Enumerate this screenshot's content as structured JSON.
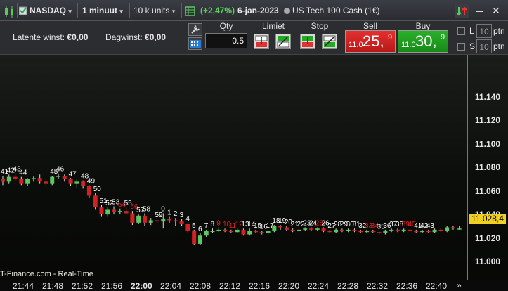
{
  "topbar": {
    "symbol": "NASDAQ",
    "timeframe": "1 minuut",
    "units": "10 k units",
    "change": "(+2,47%)",
    "date": "6-jan-2023",
    "instrument": "US Tech 100 Cash (1€)"
  },
  "panel": {
    "latent_label": "Latente winst:",
    "latent_value": "€0,00",
    "day_label": "Dagwinst:",
    "day_value": "€0,00",
    "qty_label": "Qty",
    "qty_value": "0.5",
    "limit_label": "Limiet",
    "stop_label": "Stop",
    "sell_label": "Sell",
    "buy_label": "Buy",
    "sell_small": "11.0",
    "sell_big": "25,",
    "sell_sup": "9",
    "buy_small": "11.0",
    "buy_big": "30,",
    "buy_sup": "9",
    "l_label": "L",
    "s_label": "S",
    "l_value": "10",
    "s_value": "10",
    "ptn_label": "ptn"
  },
  "chart_data": {
    "type": "candlestick",
    "yticks": [
      "11.140",
      "11.120",
      "11.100",
      "11.080",
      "11.060",
      "11.040",
      "11.020",
      "11.000"
    ],
    "xticks": [
      "21:44",
      "21:48",
      "21:52",
      "21:56",
      "22:00",
      "22:04",
      "22:08",
      "22:12",
      "22:16",
      "22:20",
      "22:24",
      "22:28",
      "22:32",
      "22:36",
      "22:40"
    ],
    "current_price": "11.028,4",
    "watermark": "T-Finance.com - Real-Time",
    "colors": {
      "up": "#5cc85c",
      "down": "#d42020",
      "price_box": "#f0d020"
    },
    "candles": [
      {
        "o": 11070,
        "c": 11068,
        "h": 11073,
        "l": 11065
      },
      {
        "o": 11068,
        "c": 11072,
        "h": 11074,
        "l": 11066
      },
      {
        "o": 11072,
        "c": 11070,
        "h": 11075,
        "l": 11068
      },
      {
        "o": 11070,
        "c": 11066,
        "h": 11072,
        "l": 11065
      },
      {
        "o": 11066,
        "c": 11070,
        "h": 11071,
        "l": 11064
      },
      {
        "o": 11070,
        "c": 11071,
        "h": 11073,
        "l": 11068
      },
      {
        "o": 11071,
        "c": 11068,
        "h": 11074,
        "l": 11066
      },
      {
        "o": 11068,
        "c": 11066,
        "h": 11070,
        "l": 11064
      },
      {
        "o": 11066,
        "c": 11072,
        "h": 11073,
        "l": 11065
      },
      {
        "o": 11072,
        "c": 11073,
        "h": 11075,
        "l": 11070
      },
      {
        "o": 11073,
        "c": 11070,
        "h": 11074,
        "l": 11068
      },
      {
        "o": 11070,
        "c": 11066,
        "h": 11071,
        "l": 11064
      },
      {
        "o": 11066,
        "c": 11068,
        "h": 11070,
        "l": 11063
      },
      {
        "o": 11068,
        "c": 11064,
        "h": 11069,
        "l": 11062
      },
      {
        "o": 11064,
        "c": 11056,
        "h": 11065,
        "l": 11054
      },
      {
        "o": 11056,
        "c": 11046,
        "h": 11058,
        "l": 11044
      },
      {
        "o": 11046,
        "c": 11040,
        "h": 11048,
        "l": 11038
      },
      {
        "o": 11040,
        "c": 11044,
        "h": 11046,
        "l": 11038
      },
      {
        "o": 11044,
        "c": 11042,
        "h": 11047,
        "l": 11040
      },
      {
        "o": 11042,
        "c": 11043,
        "h": 11045,
        "l": 11040
      },
      {
        "o": 11043,
        "c": 11041,
        "h": 11046,
        "l": 11040
      },
      {
        "o": 11041,
        "c": 11033,
        "h": 11043,
        "l": 11031
      },
      {
        "o": 11033,
        "c": 11039,
        "h": 11040,
        "l": 11032
      },
      {
        "o": 11039,
        "c": 11033,
        "h": 11041,
        "l": 11030
      },
      {
        "o": 11033,
        "c": 11035,
        "h": 11037,
        "l": 11031
      },
      {
        "o": 11035,
        "c": 11034,
        "h": 11036,
        "l": 11032
      },
      {
        "o": 11034,
        "c": 11036,
        "h": 11041,
        "l": 11028
      },
      {
        "o": 11036,
        "c": 11035,
        "h": 11038,
        "l": 11033
      },
      {
        "o": 11035,
        "c": 11034,
        "h": 11037,
        "l": 11030
      },
      {
        "o": 11034,
        "c": 11032,
        "h": 11036,
        "l": 11030
      },
      {
        "o": 11032,
        "c": 11026,
        "h": 11033,
        "l": 11024
      },
      {
        "o": 11026,
        "c": 11015,
        "h": 11027,
        "l": 11014
      },
      {
        "o": 11015,
        "c": 11022,
        "h": 11024,
        "l": 11014
      },
      {
        "o": 11022,
        "c": 11026,
        "h": 11027,
        "l": 11021
      },
      {
        "o": 11026,
        "c": 11026,
        "h": 11028,
        "l": 11024
      },
      {
        "o": 11026,
        "c": 11027,
        "h": 11029,
        "l": 11025
      },
      {
        "o": 11027,
        "c": 11026,
        "h": 11028,
        "l": 11025
      },
      {
        "o": 11026,
        "c": 11025,
        "h": 11027,
        "l": 11024
      },
      {
        "o": 11025,
        "c": 11027,
        "h": 11028,
        "l": 11024
      },
      {
        "o": 11027,
        "c": 11023,
        "h": 11028,
        "l": 11022
      },
      {
        "o": 11023,
        "c": 11026,
        "h": 11028,
        "l": 11022
      },
      {
        "o": 11026,
        "c": 11025,
        "h": 11027,
        "l": 11024
      },
      {
        "o": 11025,
        "c": 11024,
        "h": 11026,
        "l": 11023
      },
      {
        "o": 11024,
        "c": 11026,
        "h": 11027,
        "l": 11023
      },
      {
        "o": 11026,
        "c": 11030,
        "h": 11031,
        "l": 11025
      },
      {
        "o": 11030,
        "c": 11029,
        "h": 11031,
        "l": 11027
      },
      {
        "o": 11029,
        "c": 11027,
        "h": 11030,
        "l": 11026
      },
      {
        "o": 11027,
        "c": 11026,
        "h": 11028,
        "l": 11025
      },
      {
        "o": 11026,
        "c": 11027,
        "h": 11028,
        "l": 11025
      },
      {
        "o": 11027,
        "c": 11028,
        "h": 11029,
        "l": 11026
      },
      {
        "o": 11028,
        "c": 11027,
        "h": 11029,
        "l": 11026
      },
      {
        "o": 11027,
        "c": 11028,
        "h": 11029,
        "l": 11026
      },
      {
        "o": 11028,
        "c": 11026,
        "h": 11029,
        "l": 11025
      },
      {
        "o": 11026,
        "c": 11025,
        "h": 11027,
        "l": 11024
      },
      {
        "o": 11025,
        "c": 11027,
        "h": 11028,
        "l": 11024
      },
      {
        "o": 11027,
        "c": 11026,
        "h": 11028,
        "l": 11025
      },
      {
        "o": 11026,
        "c": 11027,
        "h": 11028,
        "l": 11025
      },
      {
        "o": 11027,
        "c": 11026,
        "h": 11028,
        "l": 11025
      },
      {
        "o": 11026,
        "c": 11025,
        "h": 11027,
        "l": 11024
      },
      {
        "o": 11025,
        "c": 11026,
        "h": 11027,
        "l": 11024
      },
      {
        "o": 11026,
        "c": 11025,
        "h": 11027,
        "l": 11024
      },
      {
        "o": 11025,
        "c": 11024,
        "h": 11026,
        "l": 11023
      },
      {
        "o": 11024,
        "c": 11026,
        "h": 11027,
        "l": 11023
      },
      {
        "o": 11026,
        "c": 11027,
        "h": 11028,
        "l": 11025
      },
      {
        "o": 11027,
        "c": 11026,
        "h": 11028,
        "l": 11025
      },
      {
        "o": 11026,
        "c": 11027,
        "h": 11028,
        "l": 11025
      },
      {
        "o": 11027,
        "c": 11026,
        "h": 11028,
        "l": 11025
      },
      {
        "o": 11026,
        "c": 11025,
        "h": 11027,
        "l": 11024
      },
      {
        "o": 11025,
        "c": 11026,
        "h": 11027,
        "l": 11024
      },
      {
        "o": 11026,
        "c": 11025,
        "h": 11027,
        "l": 11024
      },
      {
        "o": 11025,
        "c": 11027,
        "h": 11028,
        "l": 11024
      },
      {
        "o": 11027,
        "c": 11026,
        "h": 11028,
        "l": 11025
      },
      {
        "o": 11026,
        "c": 11029,
        "h": 11030,
        "l": 11025
      },
      {
        "o": 11029,
        "c": 11028,
        "h": 11030,
        "l": 11027
      },
      {
        "o": 11028,
        "c": 11028,
        "h": 11030,
        "l": 11027
      }
    ],
    "labels": [
      {
        "i": 0,
        "t": "41",
        "c": "w"
      },
      {
        "i": 1,
        "t": "42",
        "c": "w"
      },
      {
        "i": 2,
        "t": "43",
        "c": "w"
      },
      {
        "i": 3,
        "t": "44",
        "c": "w"
      },
      {
        "i": 8,
        "t": "45",
        "c": "w"
      },
      {
        "i": 9,
        "t": "46",
        "c": "w"
      },
      {
        "i": 11,
        "t": "47",
        "c": "w"
      },
      {
        "i": 13,
        "t": "48",
        "c": "w"
      },
      {
        "i": 14,
        "t": "49",
        "c": "w"
      },
      {
        "i": 15,
        "t": "50",
        "c": "w"
      },
      {
        "i": 16,
        "t": "51",
        "c": "w"
      },
      {
        "i": 17,
        "t": "52",
        "c": "w"
      },
      {
        "i": 18,
        "t": "53",
        "c": "w"
      },
      {
        "i": 19,
        "t": "54",
        "c": "r"
      },
      {
        "i": 20,
        "t": "55",
        "c": "w"
      },
      {
        "i": 21,
        "t": "56",
        "c": "r"
      },
      {
        "i": 22,
        "t": "57",
        "c": "w"
      },
      {
        "i": 23,
        "t": "58",
        "c": "w"
      },
      {
        "i": 25,
        "t": "59",
        "c": "w"
      },
      {
        "i": 26,
        "t": "0",
        "c": "w"
      },
      {
        "i": 27,
        "t": "1",
        "c": "w"
      },
      {
        "i": 28,
        "t": "2",
        "c": "w"
      },
      {
        "i": 29,
        "t": "3",
        "c": "w"
      },
      {
        "i": 30,
        "t": "4",
        "c": "w"
      },
      {
        "i": 31,
        "t": "5",
        "c": "w"
      },
      {
        "i": 32,
        "t": "6",
        "c": "w"
      },
      {
        "i": 33,
        "t": "7",
        "c": "w"
      },
      {
        "i": 34,
        "t": "8",
        "c": "w"
      },
      {
        "i": 35,
        "t": "9",
        "c": "r"
      },
      {
        "i": 36,
        "t": "10",
        "c": "r"
      },
      {
        "i": 37,
        "t": "11",
        "c": "r"
      },
      {
        "i": 38,
        "t": "12",
        "c": "r"
      },
      {
        "i": 39,
        "t": "13",
        "c": "w"
      },
      {
        "i": 40,
        "t": "14",
        "c": "w"
      },
      {
        "i": 41,
        "t": "15",
        "c": "w"
      },
      {
        "i": 42,
        "t": "16",
        "c": "w"
      },
      {
        "i": 43,
        "t": "17",
        "c": "w"
      },
      {
        "i": 44,
        "t": "18",
        "c": "w"
      },
      {
        "i": 45,
        "t": "19",
        "c": "w"
      },
      {
        "i": 46,
        "t": "20",
        "c": "w"
      },
      {
        "i": 47,
        "t": "21",
        "c": "w"
      },
      {
        "i": 48,
        "t": "22",
        "c": "w"
      },
      {
        "i": 49,
        "t": "23",
        "c": "w"
      },
      {
        "i": 50,
        "t": "24",
        "c": "w"
      },
      {
        "i": 51,
        "t": "25",
        "c": "r"
      },
      {
        "i": 52,
        "t": "26",
        "c": "w"
      },
      {
        "i": 53,
        "t": "27",
        "c": "w"
      },
      {
        "i": 54,
        "t": "28",
        "c": "w"
      },
      {
        "i": 55,
        "t": "29",
        "c": "w"
      },
      {
        "i": 56,
        "t": "30",
        "c": "w"
      },
      {
        "i": 57,
        "t": "31",
        "c": "w"
      },
      {
        "i": 58,
        "t": "32",
        "c": "w"
      },
      {
        "i": 59,
        "t": "33",
        "c": "r"
      },
      {
        "i": 60,
        "t": "34",
        "c": "r"
      },
      {
        "i": 61,
        "t": "35",
        "c": "w"
      },
      {
        "i": 62,
        "t": "36",
        "c": "w"
      },
      {
        "i": 63,
        "t": "37",
        "c": "w"
      },
      {
        "i": 64,
        "t": "38",
        "c": "w"
      },
      {
        "i": 65,
        "t": "39",
        "c": "r"
      },
      {
        "i": 66,
        "t": "40",
        "c": "r"
      },
      {
        "i": 67,
        "t": "41",
        "c": "w"
      },
      {
        "i": 68,
        "t": "42",
        "c": "w"
      },
      {
        "i": 69,
        "t": "43",
        "c": "w"
      }
    ]
  }
}
